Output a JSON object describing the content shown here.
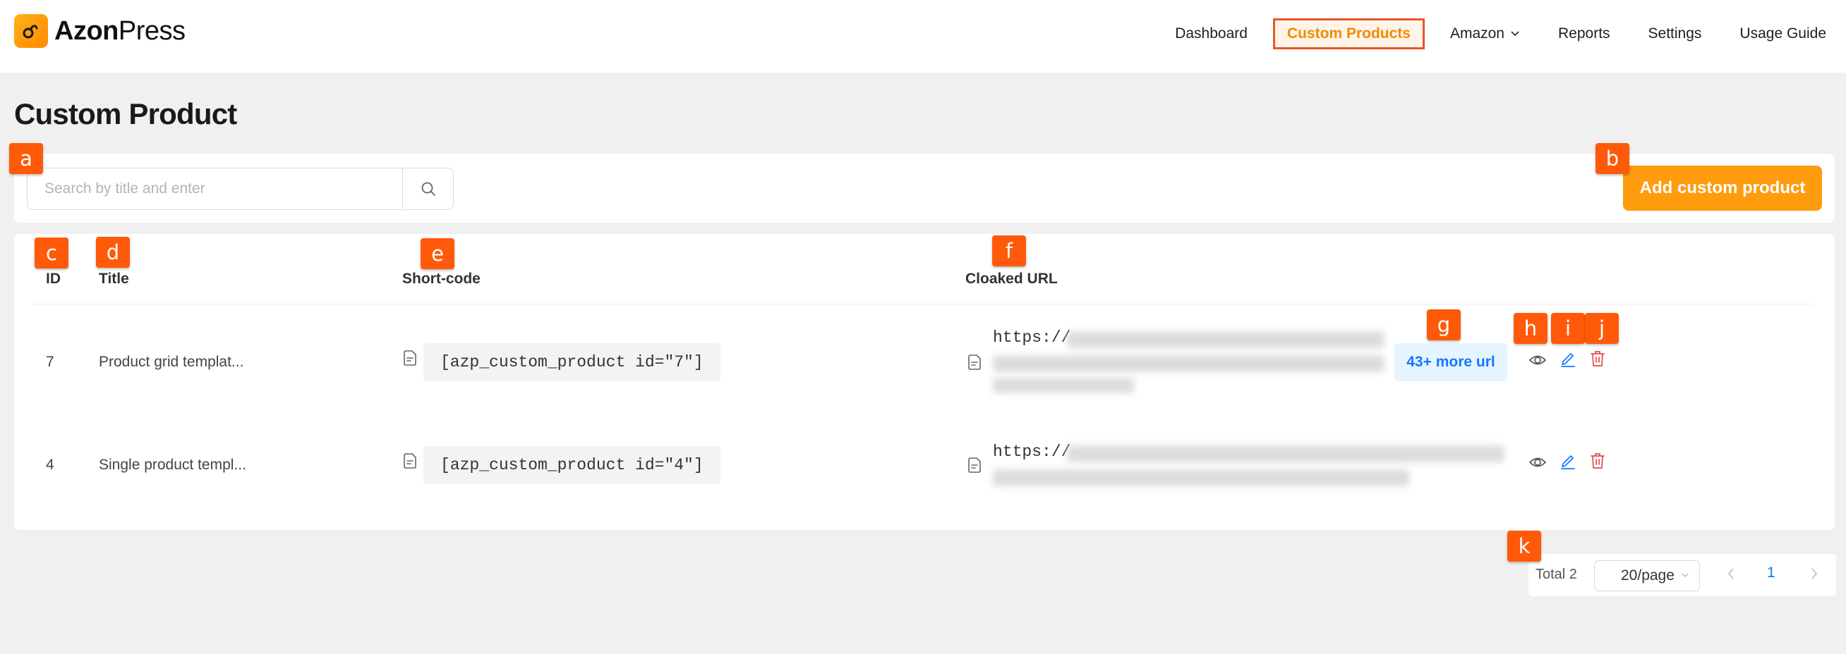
{
  "app": {
    "brand_bold": "Azon",
    "brand_light": "Press"
  },
  "nav": {
    "items": [
      {
        "label": "Dashboard",
        "active": false
      },
      {
        "label": "Custom Products",
        "active": true
      },
      {
        "label": "Amazon",
        "active": false,
        "has_dropdown": true
      },
      {
        "label": "Reports",
        "active": false
      },
      {
        "label": "Settings",
        "active": false
      },
      {
        "label": "Usage Guide",
        "active": false
      }
    ]
  },
  "page": {
    "title": "Custom Product"
  },
  "search": {
    "placeholder": "Search by title and enter",
    "value": ""
  },
  "toolbar": {
    "add_label": "Add custom product"
  },
  "table": {
    "headers": {
      "id": "ID",
      "title": "Title",
      "shortcode": "Short-code",
      "cloaked_url": "Cloaked URL"
    },
    "rows": [
      {
        "id": "7",
        "title": "Product grid templat...",
        "shortcode": "[azp_custom_product id=\"7\"]",
        "url_prefix": "https://",
        "more_urls": "43+ more url"
      },
      {
        "id": "4",
        "title": "Single product templ...",
        "shortcode": "[azp_custom_product id=\"4\"]",
        "url_prefix": "https://",
        "more_urls": ""
      }
    ]
  },
  "pagination": {
    "total": "Total 2",
    "page_size": "20/page",
    "current_page": "1"
  },
  "annotations": {
    "a": "a",
    "b": "b",
    "c": "c",
    "d": "d",
    "e": "e",
    "f": "f",
    "g": "g",
    "h": "h",
    "i": "i",
    "j": "j",
    "k": "k"
  },
  "colors": {
    "accent": "#ff9c0e",
    "active_nav_border": "#e8562a",
    "link_blue": "#1677ff",
    "delete_red": "#e5484d",
    "annotation_tag": "#ff5a0a"
  },
  "icons": {
    "logo": "azonpress-logo-icon",
    "search": "search-icon",
    "view": "eye-icon",
    "edit": "pencil-icon",
    "delete": "trash-icon",
    "document": "document-icon",
    "dropdown": "chevron-down-icon"
  }
}
